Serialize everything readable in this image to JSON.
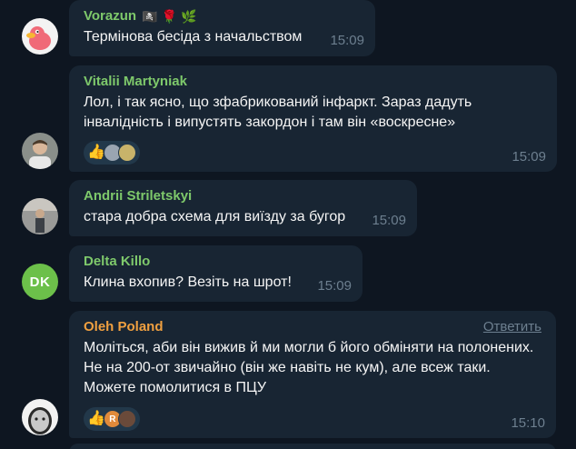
{
  "messages": [
    {
      "sender": "Vorazun",
      "sender_color": "#7ec96b",
      "sender_emojis": [
        "🏴‍☠️",
        "🌹",
        "🌿"
      ],
      "text": "Термінова бесіда з начальством",
      "time": "15:09"
    },
    {
      "sender": "Vitalii Martyniak",
      "sender_color": "#7ec96b",
      "text": "Лол, і так ясно, що зфабрикований інфаркт. Зараз дадуть інвалідність і випустять закордон і там він «воскресне»",
      "reaction_emoji": "👍",
      "time": "15:09"
    },
    {
      "sender": "Andrii Striletskyi",
      "sender_color": "#7ec96b",
      "text": "стара добра схема для виїзду за бугор",
      "time": "15:09"
    },
    {
      "sender": "Delta Killo",
      "sender_color": "#7ec96b",
      "avatar_initials": "DK",
      "text": "Клина вхопив? Везіть на шрот!",
      "time": "15:09"
    },
    {
      "sender": "Oleh Poland",
      "sender_color": "#f0a040",
      "reply_label": "Ответить",
      "text": "Моліться, аби він вижив й ми могли б його обміняти на полонених. Не на 200-от звичайно (він же навіть не кум), але всеж таки. Можете помолитися в ПЦУ",
      "reaction_emoji": "👍",
      "reaction_avatar_letter": "R",
      "time": "15:10"
    }
  ]
}
